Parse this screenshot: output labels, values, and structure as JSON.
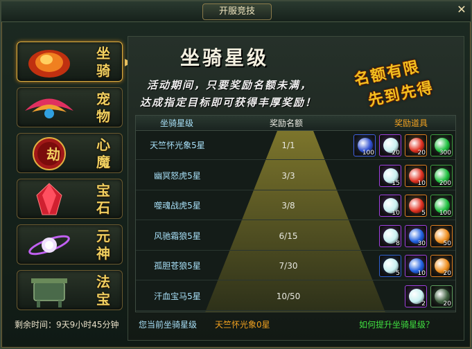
{
  "window": {
    "title": "开服竞技",
    "close_icon": "close-icon"
  },
  "sidebar": {
    "items": [
      {
        "label": "坐骑",
        "icon": "fire-mount-icon",
        "active": true
      },
      {
        "label": "宠物",
        "icon": "phoenix-pet-icon"
      },
      {
        "label": "心魔",
        "icon": "demon-seal-icon",
        "seal": "劫"
      },
      {
        "label": "宝石",
        "icon": "red-crystal-icon"
      },
      {
        "label": "元神",
        "icon": "spirit-orb-icon"
      },
      {
        "label": "法宝",
        "icon": "cauldron-icon"
      }
    ]
  },
  "banner": {
    "title": "坐骑星级",
    "line1": "活动期间，只要奖励名额未满，",
    "line2": "达成指定目标即可获得丰厚奖励！",
    "stamp1": "名额有限",
    "stamp2": "先到先得"
  },
  "table": {
    "headers": {
      "star": "坐骑星级",
      "quota": "奖励名额",
      "rewards": "奖励道具"
    },
    "rows": [
      {
        "name": "天竺怀光象5星",
        "quota": "1/1",
        "items": [
          {
            "icon": "blue-orb-icon",
            "count": "100",
            "color": "#3050d0",
            "frame": "#4060e0"
          },
          {
            "icon": "white-egg-icon",
            "count": "20",
            "color": "#c8f0f0",
            "frame": "#a040e0"
          },
          {
            "icon": "red-gem-icon",
            "count": "20",
            "color": "#e03020",
            "frame": "#e08020"
          },
          {
            "icon": "green-orb-icon",
            "count": "300",
            "color": "#20c040",
            "frame": "#40a040"
          }
        ]
      },
      {
        "name": "幽冥怒虎5星",
        "quota": "3/3",
        "items": [
          {
            "icon": "white-egg-icon",
            "count": "15",
            "color": "#c8f0f0",
            "frame": "#a040e0"
          },
          {
            "icon": "red-gem-icon",
            "count": "10",
            "color": "#e03020",
            "frame": "#e08020"
          },
          {
            "icon": "green-orb-icon",
            "count": "200",
            "color": "#20c040",
            "frame": "#40a040"
          }
        ]
      },
      {
        "name": "噬魂战虎5星",
        "quota": "3/8",
        "items": [
          {
            "icon": "white-egg-icon",
            "count": "10",
            "color": "#c8f0f0",
            "frame": "#a040e0"
          },
          {
            "icon": "red-gem-icon",
            "count": "5",
            "color": "#e03020",
            "frame": "#e08020"
          },
          {
            "icon": "green-orb-icon",
            "count": "100",
            "color": "#20c040",
            "frame": "#40a040"
          }
        ]
      },
      {
        "name": "风驰霜狼5星",
        "quota": "6/15",
        "items": [
          {
            "icon": "white-egg-icon",
            "count": "8",
            "color": "#c8f0f0",
            "frame": "#a040e0"
          },
          {
            "icon": "blue-flame-icon",
            "count": "30",
            "color": "#2060e0",
            "frame": "#a040e0"
          },
          {
            "icon": "orange-flame-icon",
            "count": "50",
            "color": "#f09020",
            "frame": "#e08020"
          }
        ]
      },
      {
        "name": "孤胆苍狼5星",
        "quota": "7/30",
        "items": [
          {
            "icon": "white-egg-icon",
            "count": "5",
            "color": "#c8f0f0",
            "frame": "#3060d0"
          },
          {
            "icon": "blue-flame-icon",
            "count": "10",
            "color": "#2060e0",
            "frame": "#a040e0"
          },
          {
            "icon": "orange-flame-icon",
            "count": "20",
            "color": "#f09020",
            "frame": "#e08020"
          }
        ]
      },
      {
        "name": "汗血宝马5星",
        "quota": "10/50",
        "items": [
          {
            "icon": "white-egg-icon",
            "count": "2",
            "color": "#c8f0f0",
            "frame": "#a040e0"
          },
          {
            "icon": "scroll-icon",
            "count": "20",
            "color": "#406040",
            "frame": "#60a060"
          }
        ]
      }
    ]
  },
  "footer": {
    "remaining": "剩余时间：9天9小时45分钟",
    "current_label": "您当前坐骑星级",
    "current_value": "天竺怀光象0星",
    "help_link": "如何提升坐骑星级？"
  },
  "colors": {
    "gold": "#f2d060",
    "orange": "#f0a020",
    "green": "#40e040",
    "cyan": "#a8e0f8"
  }
}
